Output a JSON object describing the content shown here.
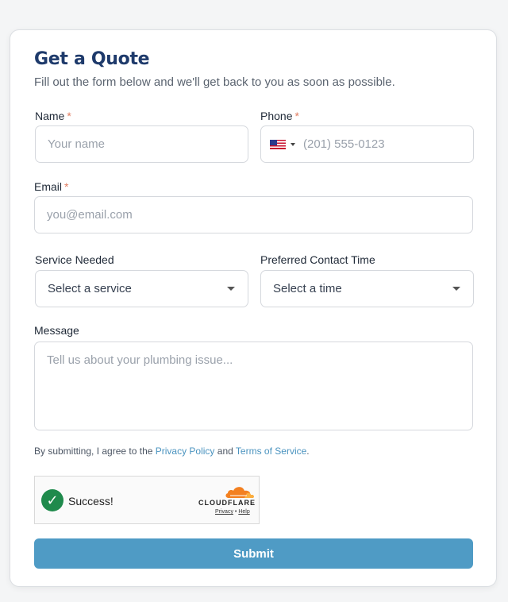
{
  "form": {
    "title": "Get a Quote",
    "subtitle": "Fill out the form below and we'll get back to you as soon as possible.",
    "required_marker": "*",
    "name": {
      "label": "Name",
      "placeholder": "Your name"
    },
    "phone": {
      "label": "Phone",
      "placeholder": "(201) 555-0123",
      "country_flag": "us-flag-icon"
    },
    "email": {
      "label": "Email",
      "placeholder": "you@email.com"
    },
    "service": {
      "label": "Service Needed",
      "selected": "Select a service"
    },
    "contact_time": {
      "label": "Preferred Contact Time",
      "selected": "Select a time"
    },
    "message": {
      "label": "Message",
      "placeholder": "Tell us about your plumbing issue..."
    },
    "terms": {
      "prefix": "By submitting, I agree to the ",
      "privacy_link": "Privacy Policy",
      "middle": " and ",
      "terms_link": "Terms of Service",
      "suffix": "."
    },
    "captcha": {
      "status": "Success!",
      "brand": "CLOUDFLARE",
      "privacy": "Privacy",
      "separator": "•",
      "help": "Help"
    },
    "submit_label": "Submit"
  },
  "colors": {
    "title": "#1e3a6b",
    "required": "#e07b5f",
    "link": "#4a93bf",
    "submit_bg": "#4f9bc5",
    "success_check": "#1f8a4c",
    "cloudflare_orange": "#f38020"
  }
}
